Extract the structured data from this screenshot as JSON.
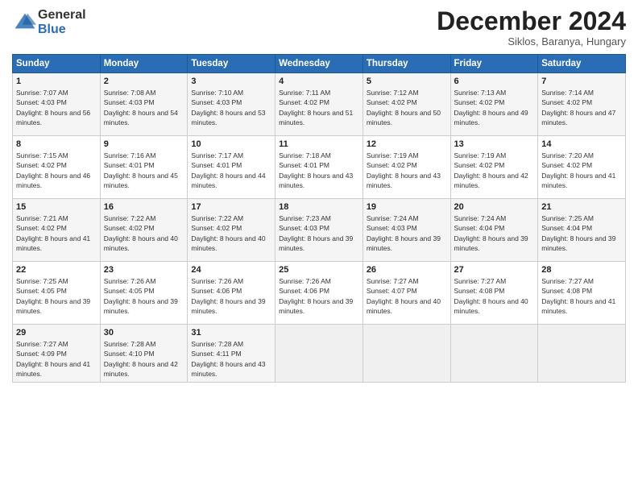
{
  "logo": {
    "text_general": "General",
    "text_blue": "Blue"
  },
  "header": {
    "month": "December 2024",
    "location": "Siklos, Baranya, Hungary"
  },
  "weekdays": [
    "Sunday",
    "Monday",
    "Tuesday",
    "Wednesday",
    "Thursday",
    "Friday",
    "Saturday"
  ],
  "weeks": [
    [
      {
        "day": "1",
        "sunrise": "7:07 AM",
        "sunset": "4:03 PM",
        "daylight": "8 hours and 56 minutes."
      },
      {
        "day": "2",
        "sunrise": "7:08 AM",
        "sunset": "4:03 PM",
        "daylight": "8 hours and 54 minutes."
      },
      {
        "day": "3",
        "sunrise": "7:10 AM",
        "sunset": "4:03 PM",
        "daylight": "8 hours and 53 minutes."
      },
      {
        "day": "4",
        "sunrise": "7:11 AM",
        "sunset": "4:02 PM",
        "daylight": "8 hours and 51 minutes."
      },
      {
        "day": "5",
        "sunrise": "7:12 AM",
        "sunset": "4:02 PM",
        "daylight": "8 hours and 50 minutes."
      },
      {
        "day": "6",
        "sunrise": "7:13 AM",
        "sunset": "4:02 PM",
        "daylight": "8 hours and 49 minutes."
      },
      {
        "day": "7",
        "sunrise": "7:14 AM",
        "sunset": "4:02 PM",
        "daylight": "8 hours and 47 minutes."
      }
    ],
    [
      {
        "day": "8",
        "sunrise": "7:15 AM",
        "sunset": "4:02 PM",
        "daylight": "8 hours and 46 minutes."
      },
      {
        "day": "9",
        "sunrise": "7:16 AM",
        "sunset": "4:01 PM",
        "daylight": "8 hours and 45 minutes."
      },
      {
        "day": "10",
        "sunrise": "7:17 AM",
        "sunset": "4:01 PM",
        "daylight": "8 hours and 44 minutes."
      },
      {
        "day": "11",
        "sunrise": "7:18 AM",
        "sunset": "4:01 PM",
        "daylight": "8 hours and 43 minutes."
      },
      {
        "day": "12",
        "sunrise": "7:19 AM",
        "sunset": "4:02 PM",
        "daylight": "8 hours and 43 minutes."
      },
      {
        "day": "13",
        "sunrise": "7:19 AM",
        "sunset": "4:02 PM",
        "daylight": "8 hours and 42 minutes."
      },
      {
        "day": "14",
        "sunrise": "7:20 AM",
        "sunset": "4:02 PM",
        "daylight": "8 hours and 41 minutes."
      }
    ],
    [
      {
        "day": "15",
        "sunrise": "7:21 AM",
        "sunset": "4:02 PM",
        "daylight": "8 hours and 41 minutes."
      },
      {
        "day": "16",
        "sunrise": "7:22 AM",
        "sunset": "4:02 PM",
        "daylight": "8 hours and 40 minutes."
      },
      {
        "day": "17",
        "sunrise": "7:22 AM",
        "sunset": "4:02 PM",
        "daylight": "8 hours and 40 minutes."
      },
      {
        "day": "18",
        "sunrise": "7:23 AM",
        "sunset": "4:03 PM",
        "daylight": "8 hours and 39 minutes."
      },
      {
        "day": "19",
        "sunrise": "7:24 AM",
        "sunset": "4:03 PM",
        "daylight": "8 hours and 39 minutes."
      },
      {
        "day": "20",
        "sunrise": "7:24 AM",
        "sunset": "4:04 PM",
        "daylight": "8 hours and 39 minutes."
      },
      {
        "day": "21",
        "sunrise": "7:25 AM",
        "sunset": "4:04 PM",
        "daylight": "8 hours and 39 minutes."
      }
    ],
    [
      {
        "day": "22",
        "sunrise": "7:25 AM",
        "sunset": "4:05 PM",
        "daylight": "8 hours and 39 minutes."
      },
      {
        "day": "23",
        "sunrise": "7:26 AM",
        "sunset": "4:05 PM",
        "daylight": "8 hours and 39 minutes."
      },
      {
        "day": "24",
        "sunrise": "7:26 AM",
        "sunset": "4:06 PM",
        "daylight": "8 hours and 39 minutes."
      },
      {
        "day": "25",
        "sunrise": "7:26 AM",
        "sunset": "4:06 PM",
        "daylight": "8 hours and 39 minutes."
      },
      {
        "day": "26",
        "sunrise": "7:27 AM",
        "sunset": "4:07 PM",
        "daylight": "8 hours and 40 minutes."
      },
      {
        "day": "27",
        "sunrise": "7:27 AM",
        "sunset": "4:08 PM",
        "daylight": "8 hours and 40 minutes."
      },
      {
        "day": "28",
        "sunrise": "7:27 AM",
        "sunset": "4:08 PM",
        "daylight": "8 hours and 41 minutes."
      }
    ],
    [
      {
        "day": "29",
        "sunrise": "7:27 AM",
        "sunset": "4:09 PM",
        "daylight": "8 hours and 41 minutes."
      },
      {
        "day": "30",
        "sunrise": "7:28 AM",
        "sunset": "4:10 PM",
        "daylight": "8 hours and 42 minutes."
      },
      {
        "day": "31",
        "sunrise": "7:28 AM",
        "sunset": "4:11 PM",
        "daylight": "8 hours and 43 minutes."
      },
      null,
      null,
      null,
      null
    ]
  ],
  "labels": {
    "sunrise": "Sunrise:",
    "sunset": "Sunset:",
    "daylight": "Daylight:"
  }
}
